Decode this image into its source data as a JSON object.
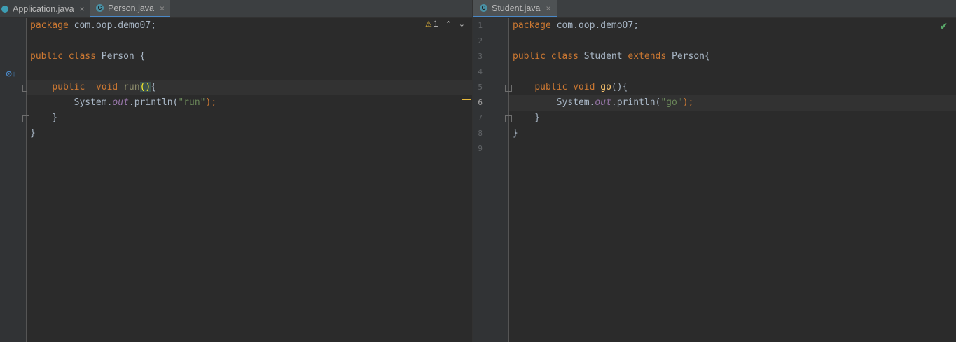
{
  "left": {
    "tabs": [
      {
        "label": "Application.java",
        "close": "×"
      },
      {
        "label": "Person.java",
        "close": "×",
        "icon": "C"
      }
    ],
    "inspection": {
      "warning_icon": "⚠",
      "count": "1",
      "up": "⌃",
      "down": "⌄"
    },
    "gutter_icon": "override-icon",
    "code": {
      "l1": {
        "kw": "package",
        "rest": " com.oop.demo07;",
        "semi": ""
      },
      "l3": {
        "kw1": "public",
        "sp": " ",
        "kw2": "class",
        "rest": " Person {"
      },
      "l5": {
        "indent": "    ",
        "kw1": "public",
        "sp1": "  ",
        "kw2": "void",
        "sp2": " ",
        "fn": "run",
        "br": "()",
        "rest": "{"
      },
      "l6": {
        "indent": "        ",
        "a": "System.",
        "fld": "out",
        "b": ".println(",
        "str": "\"run\"",
        "c": ");"
      },
      "l7": {
        "text": "    }"
      },
      "l8": {
        "text": "}"
      }
    }
  },
  "right": {
    "tabs": [
      {
        "label": "Student.java",
        "close": "×",
        "icon": "C"
      }
    ],
    "line_numbers": [
      "1",
      "2",
      "3",
      "4",
      "5",
      "6",
      "7",
      "8",
      "9"
    ],
    "status_icon": "✔",
    "code": {
      "l1": {
        "kw": "package",
        "rest": " com.oop.demo07;"
      },
      "l3": {
        "kw1": "public",
        "sp1": " ",
        "kw2": "class",
        "mid": " Student ",
        "kw3": "extends",
        "rest": " Person{"
      },
      "l5": {
        "indent": "    ",
        "kw1": "public",
        "sp1": " ",
        "kw2": "void",
        "sp2": " ",
        "fn": "go",
        "rest": "(){"
      },
      "l6": {
        "indent": "        ",
        "a": "System.",
        "fld": "out",
        "b": ".println(",
        "str": "\"go\"",
        "c": ");"
      },
      "l7": {
        "text": "    }"
      },
      "l8": {
        "text": "}"
      }
    }
  },
  "colors": {
    "background": "#2b2b2b",
    "keyword": "#cc7832",
    "string": "#6a8759",
    "field": "#9876aa",
    "function": "#ffc66d",
    "accent": "#4a88c7"
  }
}
